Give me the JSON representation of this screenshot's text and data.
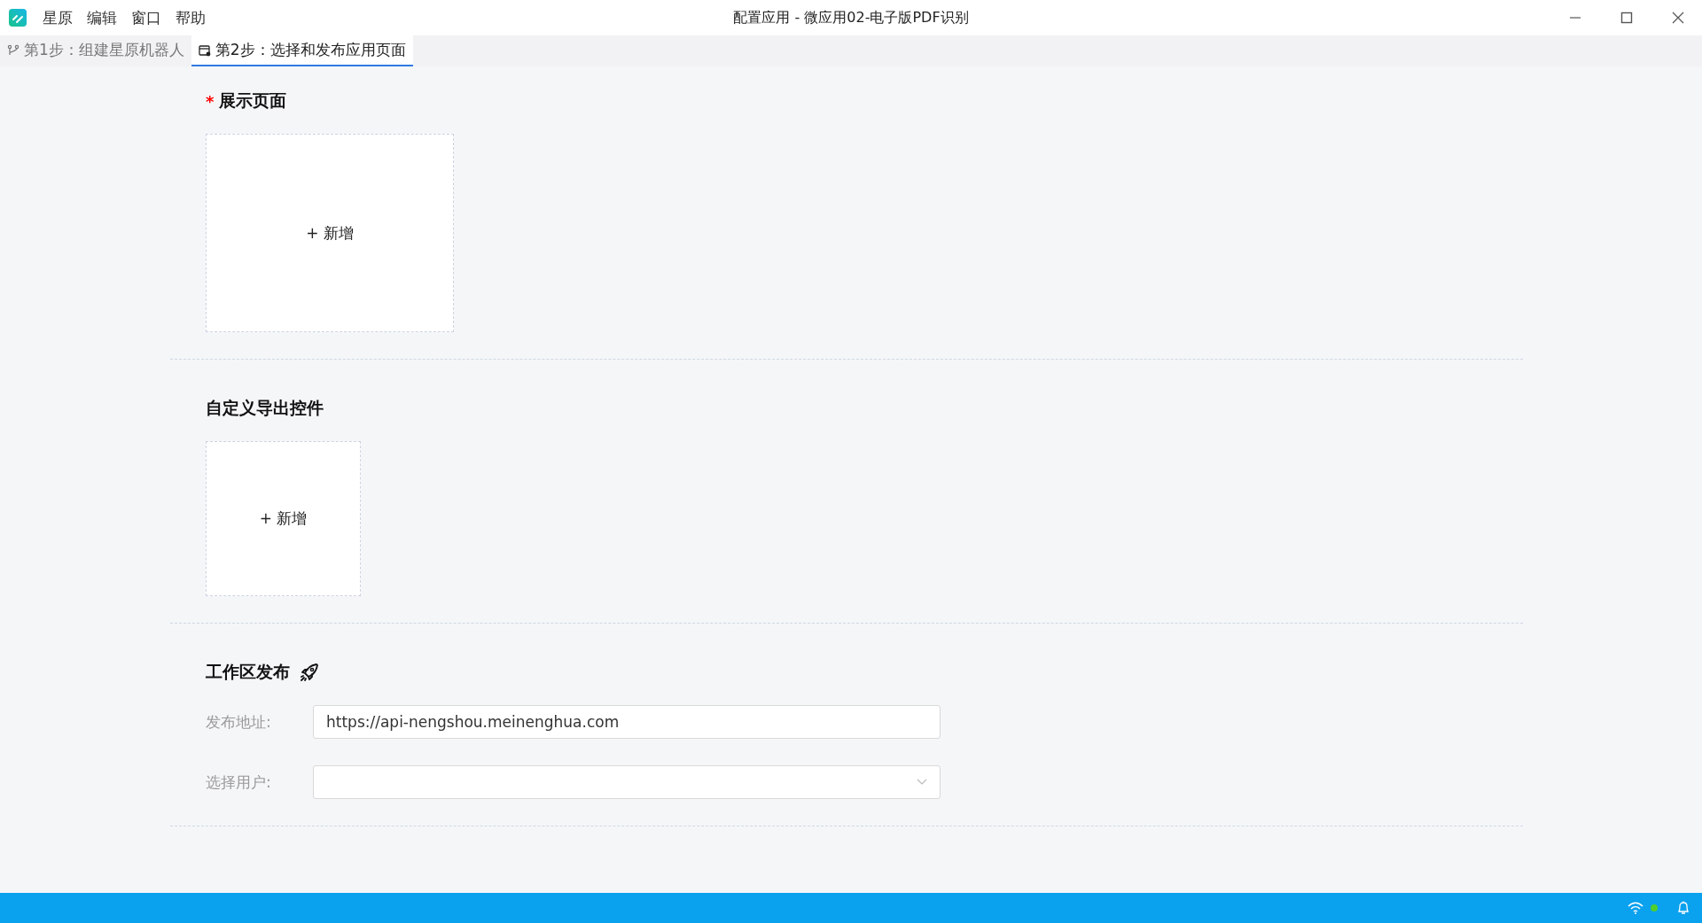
{
  "window": {
    "title": "配置应用 - 微应用02-电子版PDF识别"
  },
  "menu": [
    "星原",
    "编辑",
    "窗口",
    "帮助"
  ],
  "tabs": [
    {
      "label": "第1步：组建星原机器人",
      "selected": false,
      "kind": "branch"
    },
    {
      "label": "第2步：选择和发布应用页面",
      "selected": true,
      "kind": "window"
    }
  ],
  "sections": [
    {
      "kind": "page",
      "title": "展示页面",
      "required_mark": "*",
      "add_label": "+ 新增"
    },
    {
      "kind": "control",
      "title": "自定义导出控件",
      "add_label": "+ 新增"
    },
    {
      "kind": "publish",
      "title": "工作区发布",
      "fields": [
        {
          "kind": "text",
          "label": "发布地址:",
          "value": "https://api-nengshou.meinenghua.com"
        },
        {
          "kind": "select",
          "label": "选择用户:"
        }
      ]
    }
  ],
  "status_bar": {
    "connected": true
  }
}
